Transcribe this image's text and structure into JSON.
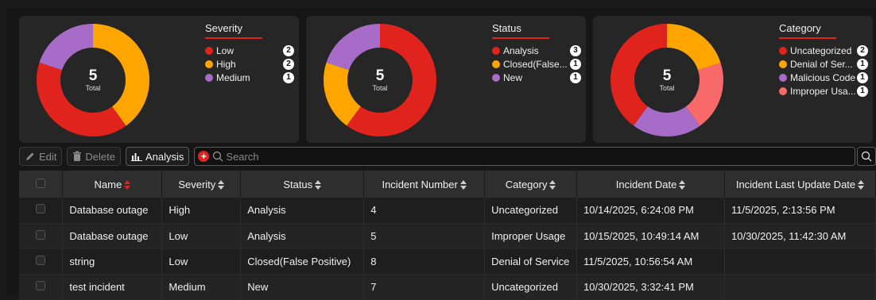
{
  "charts": [
    {
      "total": "5",
      "total_label": "Total",
      "title": "Severity",
      "items": [
        {
          "label": "Low",
          "count": "2",
          "color": "#e0231c"
        },
        {
          "label": "High",
          "count": "2",
          "color": "#ffa500"
        },
        {
          "label": "Medium",
          "count": "1",
          "color": "#a66cc8"
        }
      ]
    },
    {
      "total": "5",
      "total_label": "Total",
      "title": "Status",
      "items": [
        {
          "label": "Analysis",
          "count": "3",
          "color": "#e0231c"
        },
        {
          "label": "Closed(False...",
          "count": "1",
          "color": "#ffa500"
        },
        {
          "label": "New",
          "count": "1",
          "color": "#a66cc8"
        }
      ]
    },
    {
      "total": "5",
      "total_label": "Total",
      "title": "Category",
      "items": [
        {
          "label": "Uncategorized",
          "count": "2",
          "color": "#e0231c"
        },
        {
          "label": "Denial of Ser...",
          "count": "1",
          "color": "#ffa500"
        },
        {
          "label": "Malicious Code",
          "count": "1",
          "color": "#a66cc8"
        },
        {
          "label": "Improper Usa...",
          "count": "1",
          "color": "#f86a6a"
        }
      ]
    }
  ],
  "toolbar": {
    "edit_label": "Edit",
    "delete_label": "Delete",
    "analysis_label": "Analysis",
    "search_placeholder": "Search"
  },
  "table": {
    "columns": [
      "Name",
      "Severity",
      "Status",
      "Incident Number",
      "Category",
      "Incident Date",
      "Incident Last Update Date"
    ],
    "rows": [
      [
        "Database outage",
        "High",
        "Analysis",
        "4",
        "Uncategorized",
        "10/14/2025, 6:24:08 PM",
        "11/5/2025, 2:13:56 PM"
      ],
      [
        "Database outage",
        "Low",
        "Analysis",
        "5",
        "Improper Usage",
        "10/15/2025, 10:49:14 AM",
        "10/30/2025, 11:42:30 AM"
      ],
      [
        "string",
        "Low",
        "Closed(False Positive)",
        "8",
        "Denial of Service",
        "11/5/2025, 10:56:54 AM",
        ""
      ],
      [
        "test incident",
        "Medium",
        "New",
        "7",
        "Uncategorized",
        "10/30/2025, 3:32:41 PM",
        ""
      ]
    ]
  },
  "colors": {
    "accent": "#e0231c",
    "orange": "#ffa500",
    "purple": "#a66cc8",
    "pink": "#f86a6a"
  }
}
